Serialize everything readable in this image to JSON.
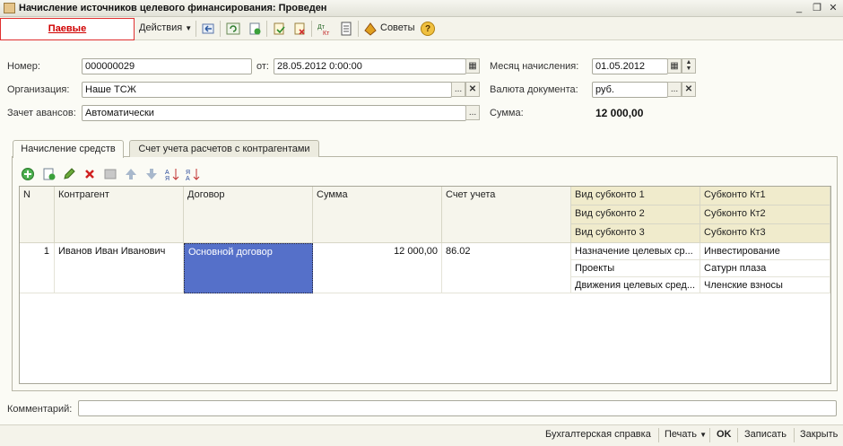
{
  "window": {
    "title": "Начисление источников целевого финансирования: Проведен",
    "icon": "document-icon",
    "controls": [
      "minimize-icon",
      "restore-icon",
      "close-icon"
    ]
  },
  "toolbar": {
    "paevye": "Паевые",
    "actions": "Действия",
    "advice": "Советы",
    "help": "?"
  },
  "form": {
    "nomer_label": "Номер:",
    "nomer_value": "000000029",
    "ot_label": "от:",
    "ot_value": "28.05.2012  0:00:00",
    "month_label": "Месяц начисления:",
    "month_value": "01.05.2012",
    "org_label": "Организация:",
    "org_value": "Наше ТСЖ",
    "currency_label": "Валюта документа:",
    "currency_value": "руб.",
    "advance_label": "Зачет авансов:",
    "advance_value": "Автоматически",
    "sum_label": "Сумма:",
    "sum_value": "12 000,00",
    "comment_label": "Комментарий:",
    "comment_value": ""
  },
  "tabs": [
    "Начисление средств",
    "Счет учета расчетов с контрагентами"
  ],
  "table": {
    "headers": {
      "n": "N",
      "contragent": "Контрагент",
      "dogovor": "Договор",
      "summa": "Сумма",
      "schet": "Счет учета",
      "vid1": "Вид субконто 1",
      "vid2": "Вид субконто 2",
      "vid3": "Вид субконто 3",
      "kt1": "Субконто Кт1",
      "kt2": "Субконто Кт2",
      "kt3": "Субконто Кт3"
    },
    "rows": [
      {
        "n": "1",
        "contragent": "Иванов Иван Иванович",
        "dogovor": "Основной договор",
        "summa": "12 000,00",
        "schet": "86.02",
        "vid1": "Назначение целевых ср...",
        "vid2": "Проекты",
        "vid3": "Движения целевых сред...",
        "kt1": "Инвестирование",
        "kt2": "Сатурн плаза",
        "kt3": "Членские взносы"
      }
    ]
  },
  "bottom": {
    "spravka": "Бухгалтерская справка",
    "print": "Печать",
    "ok": "OK",
    "save": "Записать",
    "close": "Закрыть"
  },
  "colors": {
    "selected_cell": "#5570c9",
    "paevye_red": "#d00000",
    "subconto_header": "#f0ebcc"
  }
}
